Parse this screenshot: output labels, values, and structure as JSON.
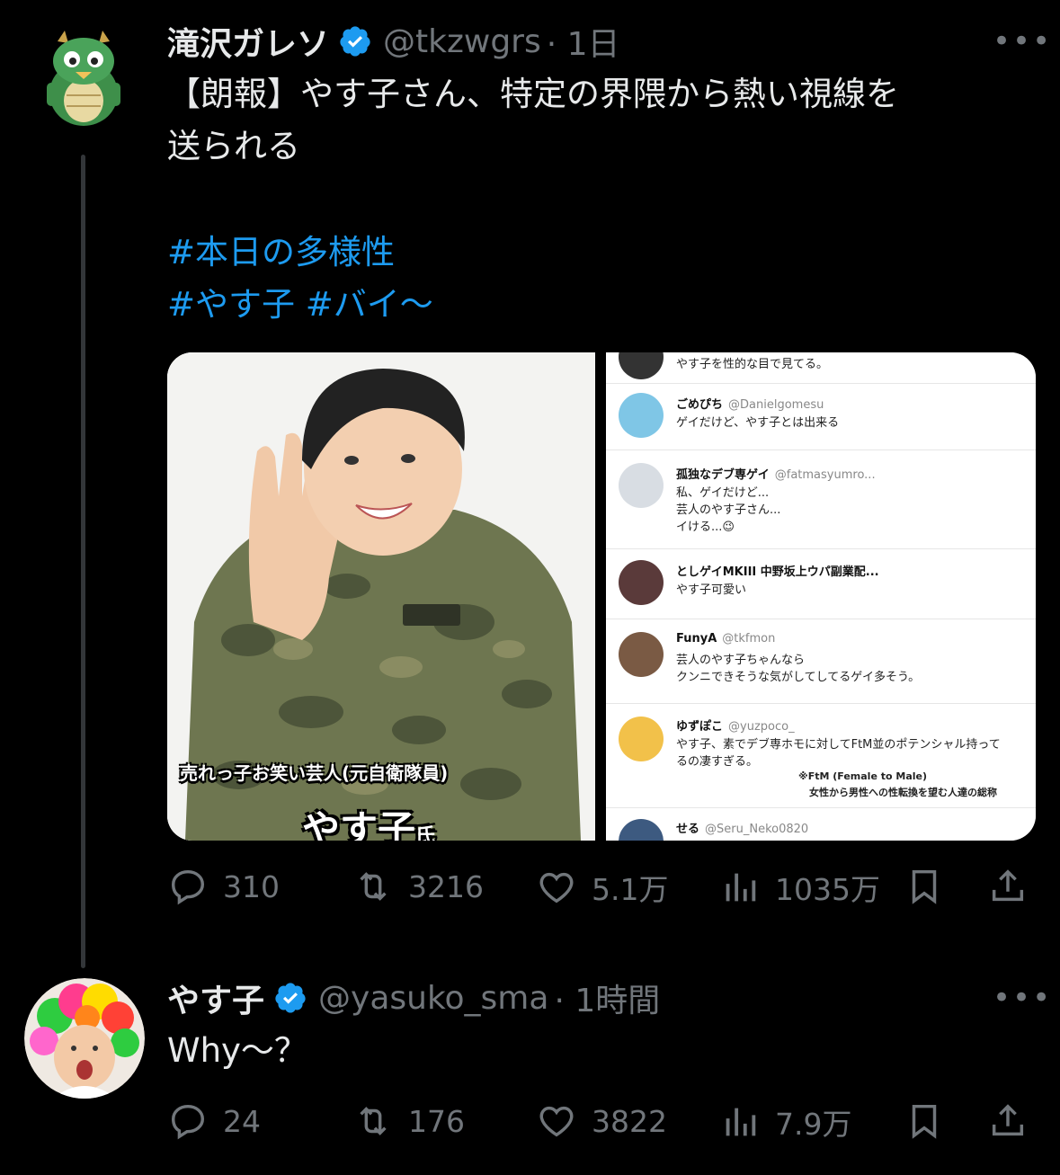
{
  "tweet1": {
    "name": "滝沢ガレソ",
    "handle": "@tkzwgrs",
    "time": "· 1日",
    "text_lines": [
      "【朗報】やす子さん、特定の界隈から熱い視線を",
      "送られる"
    ],
    "hashtag_lines": [
      "#本日の多様性",
      "#やす子 #バイ〜"
    ],
    "media": {
      "caption": "売れっ子お笑い芸人(元自衛隊員)",
      "big_name": "やす子",
      "big_name_suffix": "氏",
      "replies": [
        {
          "name": "",
          "handle": "",
          "text": "やす子を性的な目で見てる。"
        },
        {
          "name": "ごめぴち",
          "handle": "@Danielgomesu",
          "text": "ゲイだけど、やす子とは出来る"
        },
        {
          "name": "孤独なデブ専ゲイ",
          "handle": "@fatmasyumro...",
          "text": "私、ゲイだけど...\n芸人のやす子さん...\nイける...😉"
        },
        {
          "name": "としゲイMKIII 中野坂上ウパ副業配...",
          "handle": "",
          "text": "やす子可愛い"
        },
        {
          "name": "FunyA",
          "handle": "@tkfmon",
          "text": "芸人のやす子ちゃんなら\nクンニできそうな気がしてしてるゲイ多そう。"
        },
        {
          "name": "ゆずぽこ",
          "handle": "@yuzpoco_",
          "text": "やす子、素でデブ専ホモに対してFtM並のポテンシャル持って\nるの凄すぎる。"
        },
        {
          "name": "せる",
          "handle": "@Seru_Neko0820",
          "text": ""
        }
      ],
      "note_line1": "※FtM (Female to Male)",
      "note_line2": "女性から男性への性転換を望む人達の総称"
    },
    "stats": {
      "replies": "310",
      "retweets": "3216",
      "likes": "5.1万",
      "views": "1035万"
    }
  },
  "tweet2": {
    "name": "やす子",
    "handle": "@yasuko_sma",
    "time": "· 1時間",
    "text": "Why〜？",
    "stats": {
      "replies": "24",
      "retweets": "176",
      "likes": "3822",
      "views": "7.9万"
    }
  },
  "colors": {
    "background": "#000000",
    "text": "#e7e9ea",
    "muted": "#71767b",
    "link": "#1d9bf0",
    "verified": "#1d9bf0"
  },
  "icons": [
    "reply-icon",
    "retweet-icon",
    "like-icon",
    "views-icon",
    "bookmark-icon",
    "share-icon",
    "verified-badge-icon",
    "more-icon"
  ]
}
